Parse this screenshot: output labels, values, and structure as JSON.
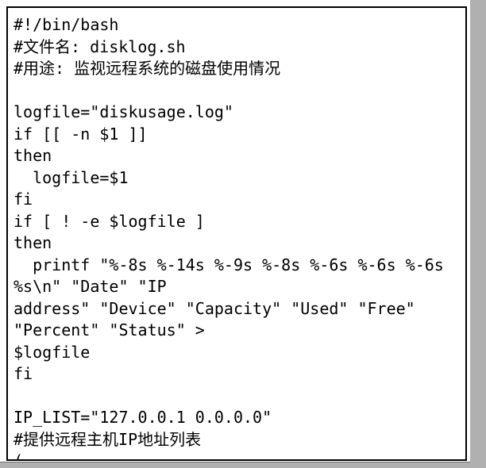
{
  "window": {
    "title": "",
    "background_color": "#ffffff",
    "chrome_color": "#b0b0b0",
    "border_color": "#000000",
    "text_color": "#000000"
  },
  "scrollbar": {
    "orientation": "vertical",
    "track_color": "#b0b0b0",
    "position": "right"
  },
  "code": {
    "language": "bash",
    "filename": "disklog.sh",
    "lines": [
      "#!/bin/bash",
      "#文件名: disklog.sh",
      "#用途: 监视远程系统的磁盘使用情况",
      "",
      "logfile=\"diskusage.log\"",
      "if [[ -n $1 ]]",
      "then",
      "  logfile=$1",
      "fi",
      "if [ ! -e $logfile ]",
      "then",
      "  printf \"%-8s %-14s %-9s %-8s %-6s %-6s %-6s",
      "%s\\n\" \"Date\" \"IP",
      "address\" \"Device\" \"Capacity\" \"Used\" \"Free\"",
      "\"Percent\" \"Status\" >",
      "$logfile",
      "fi",
      "",
      "IP_LIST=\"127.0.0.1 0.0.0.0\"",
      "#提供远程主机IP地址列表",
      "("
    ]
  }
}
